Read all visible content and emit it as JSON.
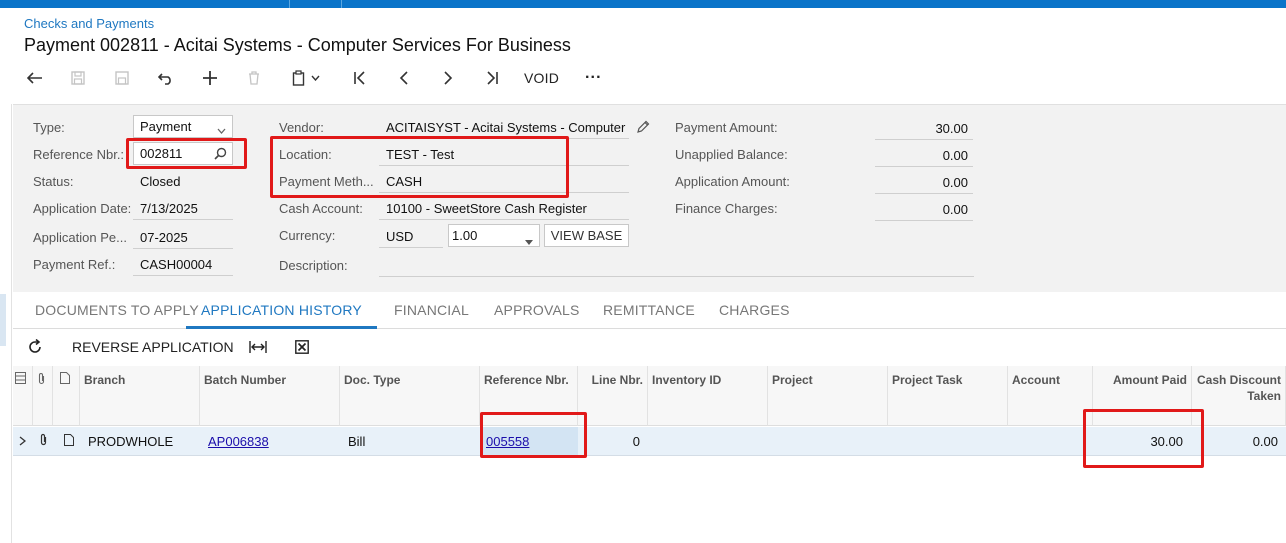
{
  "header": {
    "breadcrumb": "Checks and Payments",
    "title": "Payment 002811 - Acitai Systems - Computer Services For Business"
  },
  "toolbar": {
    "void_label": "VOID",
    "more_label": "···"
  },
  "form": {
    "type_label": "Type:",
    "type_value": "Payment",
    "refnbr_label": "Reference Nbr.:",
    "refnbr_value": "002811",
    "status_label": "Status:",
    "status_value": "Closed",
    "appdate_label": "Application Date:",
    "appdate_value": "7/13/2025",
    "appperiod_label": "Application Pe...",
    "appperiod_value": "07-2025",
    "payref_label": "Payment Ref.:",
    "payref_value": "CASH00004",
    "vendor_label": "Vendor:",
    "vendor_value": "ACITAISYST - Acitai Systems - Computer",
    "location_label": "Location:",
    "location_value": "TEST - Test",
    "paymeth_label": "Payment Meth...",
    "paymeth_value": "CASH",
    "cashacct_label": "Cash Account:",
    "cashacct_value": "10100 -  SweetStore Cash Register",
    "currency_label": "Currency:",
    "currency_value": "USD",
    "rate_value": "1.00",
    "viewbase_label": "VIEW BASE",
    "description_label": "Description:",
    "payamt_label": "Payment Amount:",
    "payamt_value": "30.00",
    "unapplied_label": "Unapplied Balance:",
    "unapplied_value": "0.00",
    "appamt_label": "Application Amount:",
    "appamt_value": "0.00",
    "fincharges_label": "Finance Charges:",
    "fincharges_value": "0.00"
  },
  "tabs": [
    {
      "label": "DOCUMENTS TO APPLY"
    },
    {
      "label": "APPLICATION HISTORY"
    },
    {
      "label": "FINANCIAL"
    },
    {
      "label": "APPROVALS"
    },
    {
      "label": "REMITTANCE"
    },
    {
      "label": "CHARGES"
    }
  ],
  "grid_toolbar": {
    "reverse_label": "REVERSE APPLICATION"
  },
  "grid": {
    "columns": {
      "branch": "Branch",
      "batch": "Batch Number",
      "doctype": "Doc. Type",
      "refnbr": "Reference Nbr.",
      "linenbr": "Line Nbr.",
      "inventory": "Inventory ID",
      "project": "Project",
      "projtask": "Project Task",
      "account": "Account",
      "amountpaid": "Amount Paid",
      "cashdisc": "Cash Discount Taken"
    },
    "rows": [
      {
        "branch": "PRODWHOLE",
        "batch": "AP006838",
        "doctype": "Bill",
        "refnbr": "005558",
        "linenbr": "0",
        "inventory": "",
        "project": "",
        "projtask": "",
        "account": "",
        "amountpaid": "30.00",
        "cashdisc": "0.00"
      }
    ]
  },
  "colors": {
    "accent": "#1f78c1",
    "topbar": "#0a74c9",
    "highlight": "#e11919"
  }
}
